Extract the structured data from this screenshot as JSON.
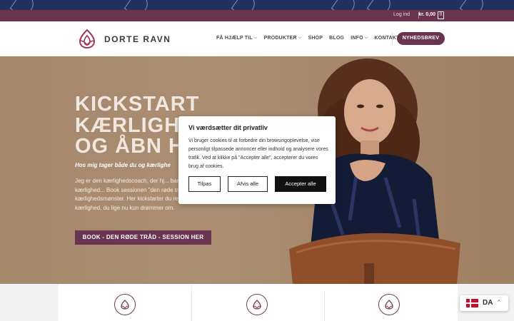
{
  "utility": {
    "login_label": "Log ind",
    "cart_total": "kr. 0,00",
    "cart_count": "0"
  },
  "header": {
    "logo_text": "DORTE RAVN",
    "nav": [
      {
        "label": "FÅ HJÆLP TIL",
        "has_dropdown": true
      },
      {
        "label": "PRODUKTER",
        "has_dropdown": true
      },
      {
        "label": "SHOP",
        "has_dropdown": false
      },
      {
        "label": "BLOG",
        "has_dropdown": false
      },
      {
        "label": "INFO",
        "has_dropdown": true
      },
      {
        "label": "KONTAKT",
        "has_dropdown": false
      }
    ],
    "newsletter_label": "NYHEDSBREV"
  },
  "hero": {
    "title_lines": [
      "KICKSTART",
      "KÆRLIGH",
      "OG ÅBN H"
    ],
    "subtitle": "Hos mig tager både du og kærlighe",
    "body": "Jeg er den kærlighedscoach, der hj... barrierer, så din drøm om kærlighed... Book sessionen \"den røde tråd\", hvo... kærlighedsmønster. Her kickstarter du rejsen frem mod den kærlighed, du lige nu kun drømmer om.",
    "cta_label": "BOOK - DEN RØDE TRÅD - SESSION HER"
  },
  "cookie_modal": {
    "title": "Vi værdsætter dit privatliv",
    "text": "Vi bruger cookies til at forbedre din browsingoplevelse, vise personligt tilpassede annoncer eller indhold og analysere vores trafik. Ved at klikke på \"Accepter alle\", accepterer du vores brug af cookies.",
    "btn_customize": "Tilpas",
    "btn_reject": "Afvis alle",
    "btn_accept": "Accepter alle"
  },
  "language": {
    "code": "DA"
  },
  "colors": {
    "brand": "#6a3350",
    "navy": "#24305e",
    "accept_bg": "#111111"
  }
}
